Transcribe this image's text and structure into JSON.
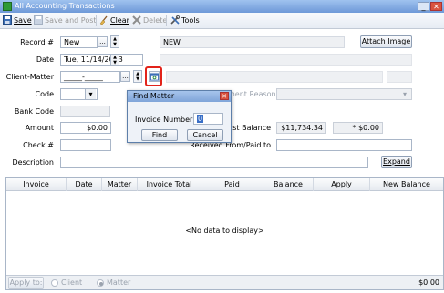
{
  "window": {
    "title": "All Accounting Transactions",
    "close_glyph": "✕",
    "minimize_glyph": "_"
  },
  "toolbar": {
    "save": "Save",
    "save_and_post": "Save and Post",
    "clear": "Clear",
    "delete": "Delete",
    "tools": "Tools"
  },
  "form": {
    "record_label": "Record #",
    "record_value": "New",
    "record_status": "NEW",
    "attach_image": "Attach Image",
    "date_label": "Date",
    "date_value": "Tue, 11/14/2023",
    "client_matter_label": "Client-Matter",
    "client_matter_value": "_____-_____",
    "code_label": "Code",
    "adjust_reason_label": "Adjustment Reason",
    "bank_code_label": "Bank Code",
    "amount_label": "Amount",
    "amount_value": "$0.00",
    "trust_balance_label": "Trust Balance",
    "trust_balance_value": "$11,734.34",
    "trust_balance_after": "* $0.00",
    "check_label": "Check #",
    "received_paid_label": "Received From/Paid to",
    "description_label": "Description",
    "expand": "Expand",
    "ellipsis": "...",
    "dropdown_glyph": "▾"
  },
  "grid": {
    "columns": [
      "Invoice",
      "Date",
      "Matter",
      "Invoice Total",
      "Paid",
      "Balance",
      "Apply",
      "New Balance"
    ],
    "empty_text": "<No data to display>",
    "apply_to": "Apply to:",
    "client_option": "Client",
    "matter_option": "Matter",
    "selected_option": "Matter",
    "total": "$0.00"
  },
  "dialog": {
    "title": "Find Matter",
    "invoice_label": "Invoice Number",
    "invoice_value": "0",
    "find": "Find",
    "cancel": "Cancel",
    "close_glyph": "✕"
  }
}
